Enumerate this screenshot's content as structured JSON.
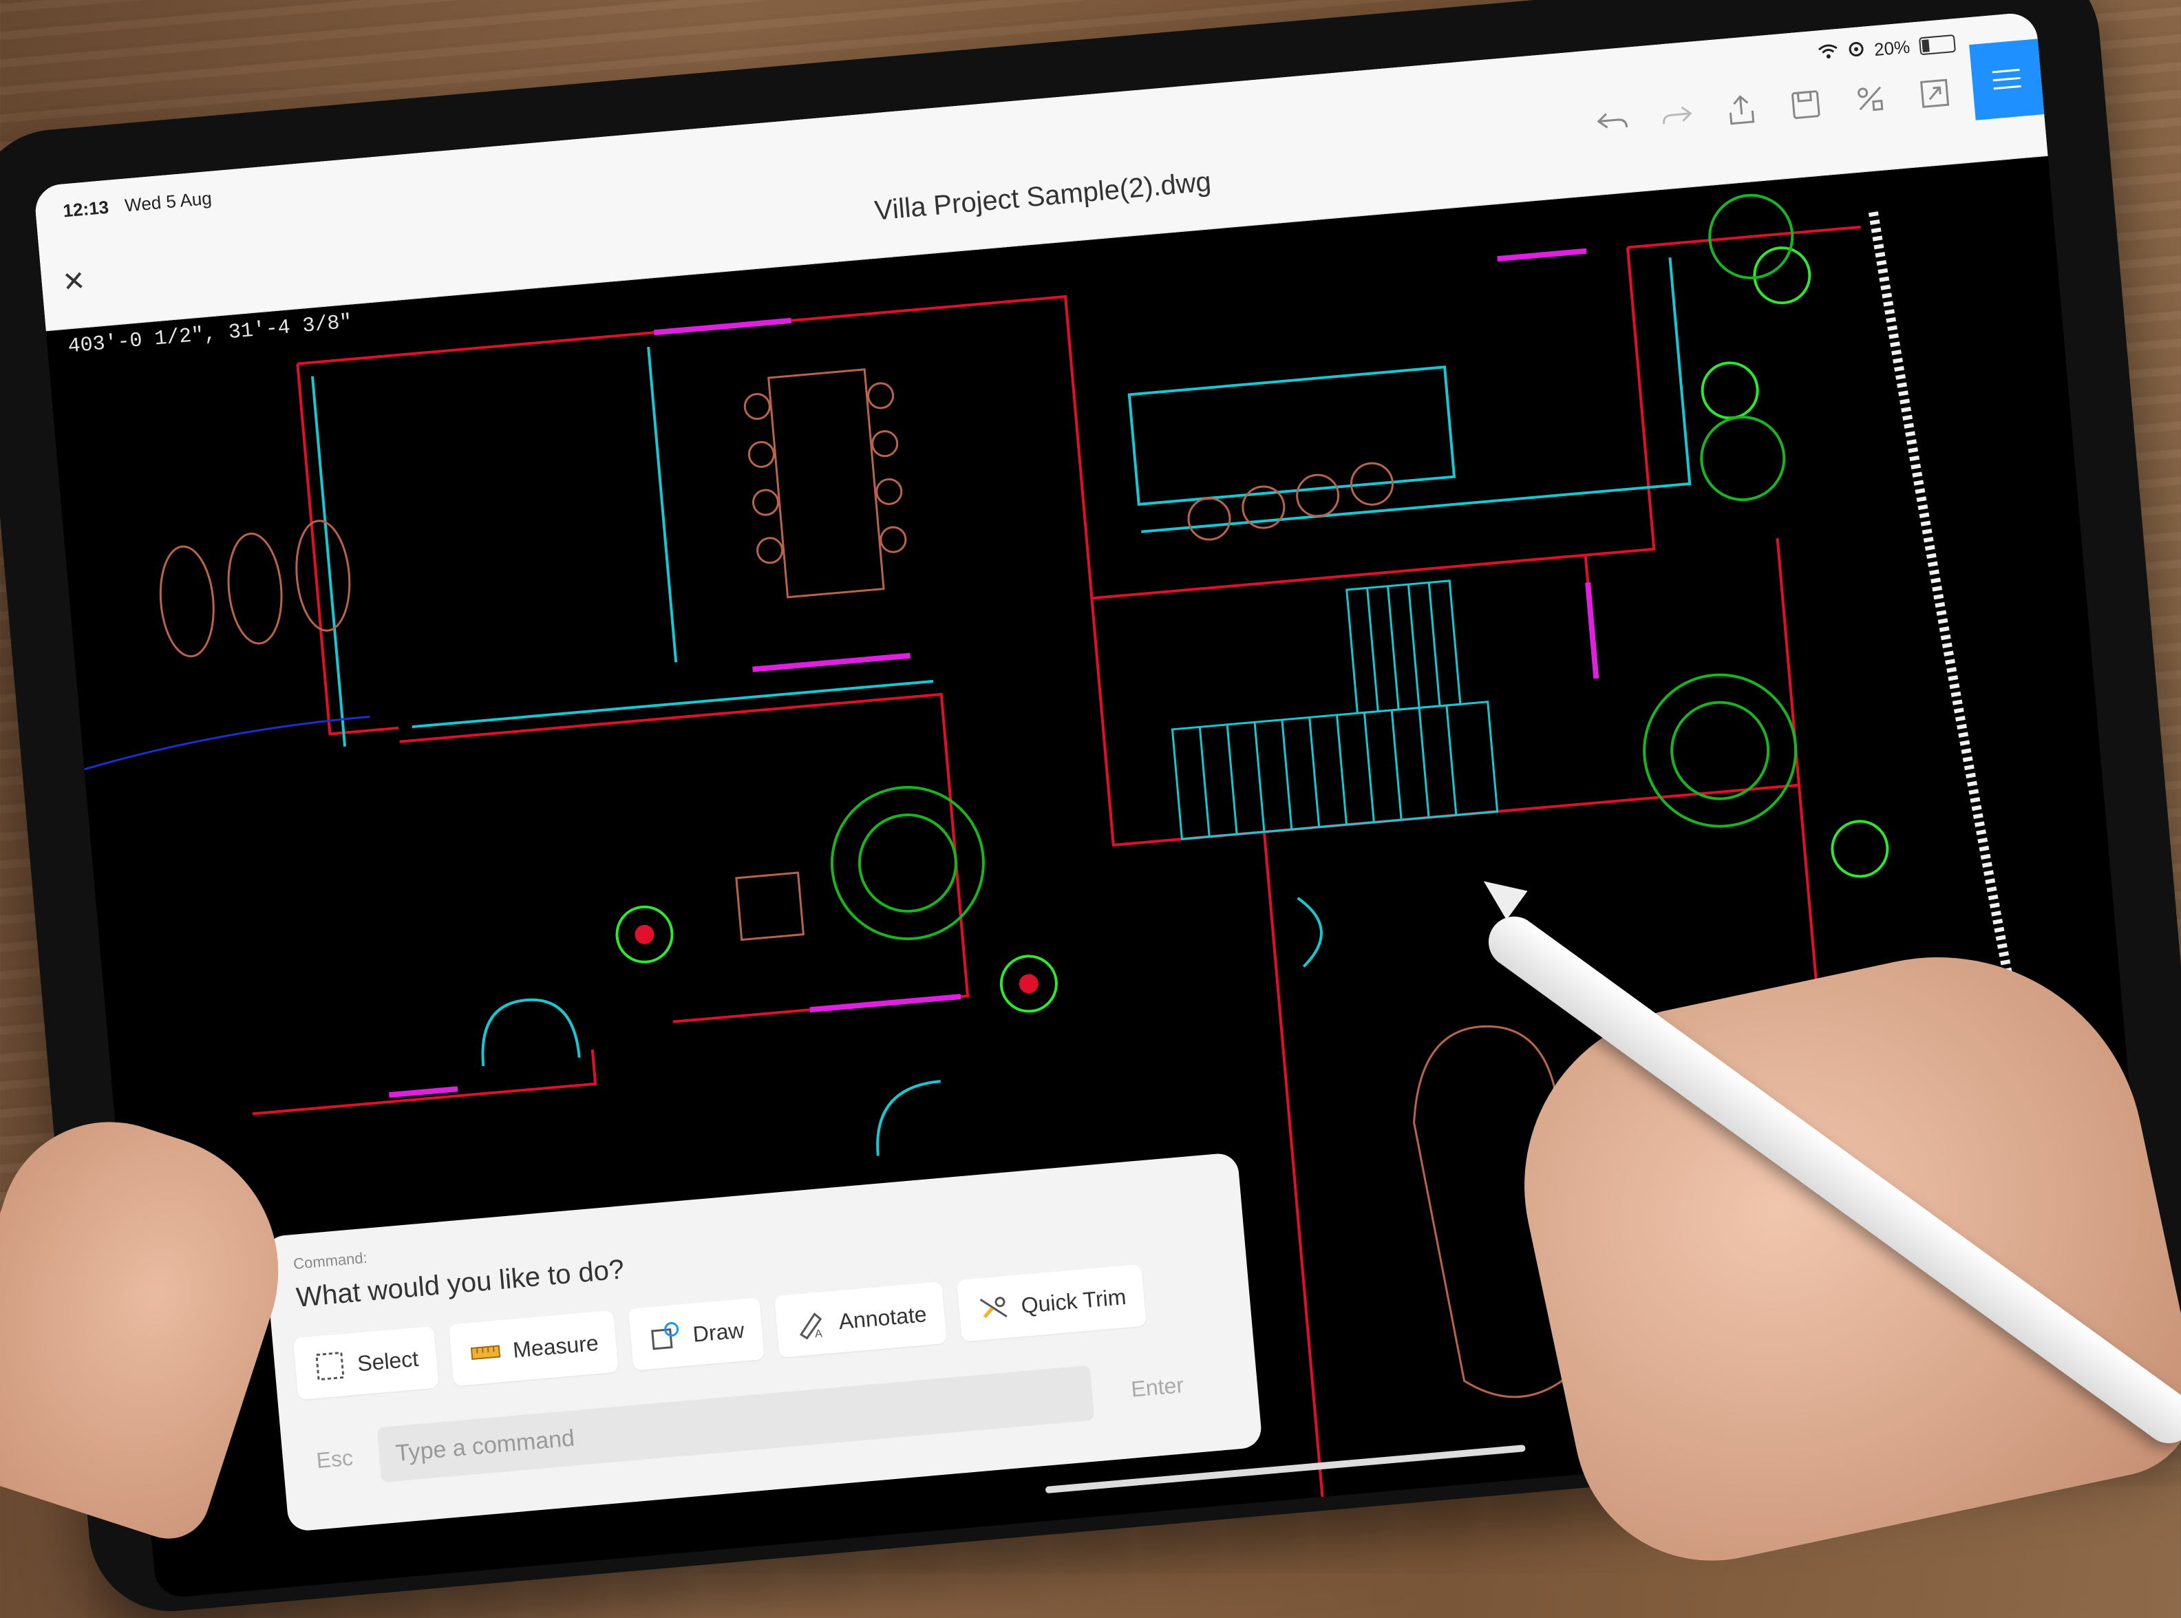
{
  "status_bar": {
    "time": "12:13",
    "date": "Wed 5 Aug",
    "battery": "20%",
    "battery_level": 0.2
  },
  "document": {
    "title": "Villa Project Sample(2).dwg",
    "coordinates": "403'-0 1/2\", 31'-4 3/8\""
  },
  "toolbar": {
    "icons": [
      "undo-icon",
      "redo-icon",
      "share-icon",
      "save-icon",
      "layers-icon",
      "fullscreen-icon",
      "menu-icon"
    ]
  },
  "command_panel": {
    "label": "Command:",
    "question": "What would you like to do?",
    "actions": [
      {
        "label": "Select",
        "icon": "select-icon"
      },
      {
        "label": "Measure",
        "icon": "measure-icon"
      },
      {
        "label": "Draw",
        "icon": "draw-icon"
      },
      {
        "label": "Annotate",
        "icon": "annotate-icon"
      },
      {
        "label": "Quick Trim",
        "icon": "quick-trim-icon"
      }
    ],
    "esc_label": "Esc",
    "input_placeholder": "Type a command",
    "enter_label": "Enter"
  },
  "colors": {
    "walls": "#e0102a",
    "outline": "#19c7d2",
    "furniture": "#b9644a",
    "windows": "#e020e0",
    "plants": "#19b51f",
    "accent": "#1e90ff"
  }
}
